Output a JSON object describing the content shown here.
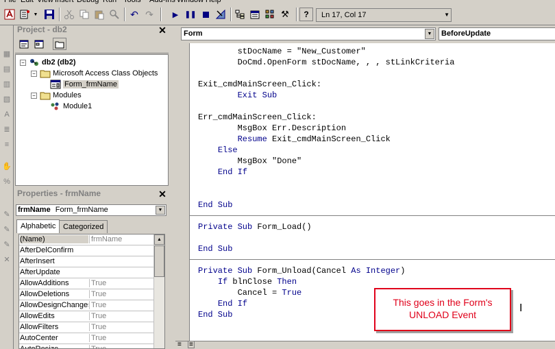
{
  "menu": [
    "File",
    "Edit",
    "View",
    "Insert",
    "Debug",
    "Run",
    "Tools",
    "Add-Ins",
    "Window",
    "Help"
  ],
  "toolbar": {
    "position_label": "Ln 17, Col 17",
    "icons": [
      "access-icon",
      "insert-module-icon",
      "save-icon",
      "cut-icon",
      "copy-icon",
      "paste-icon",
      "find-icon",
      "undo-icon",
      "redo-icon",
      "run-icon",
      "break-icon",
      "reset-icon",
      "design-mode-icon",
      "project-explorer-icon",
      "properties-icon",
      "object-browser-icon",
      "toolbox-icon",
      "help-icon"
    ]
  },
  "project": {
    "title": "Project - db2",
    "tree": [
      {
        "label": "db2 (db2)",
        "icon": "vba-project-icon",
        "expander": "−"
      },
      {
        "label": "Microsoft Access Class Objects",
        "icon": "folder-icon",
        "expander": "−"
      },
      {
        "label": "Form_frmName",
        "icon": "form-icon",
        "expander": ""
      },
      {
        "label": "Modules",
        "icon": "folder-icon",
        "expander": "−"
      },
      {
        "label": "Module1",
        "icon": "module-icon",
        "expander": ""
      }
    ]
  },
  "properties": {
    "title": "Properties - frmName",
    "object_name": "frmName",
    "object_type": "Form_frmName",
    "tabs": [
      "Alphabetic",
      "Categorized"
    ],
    "rows": [
      {
        "name": "(Name)",
        "value": "frmName"
      },
      {
        "name": "AfterDelConfirm",
        "value": ""
      },
      {
        "name": "AfterInsert",
        "value": ""
      },
      {
        "name": "AfterUpdate",
        "value": ""
      },
      {
        "name": "AllowAdditions",
        "value": "True"
      },
      {
        "name": "AllowDeletions",
        "value": "True"
      },
      {
        "name": "AllowDesignChanges",
        "value": "True"
      },
      {
        "name": "AllowEdits",
        "value": "True"
      },
      {
        "name": "AllowFilters",
        "value": "True"
      },
      {
        "name": "AutoCenter",
        "value": "True"
      },
      {
        "name": "AutoResize",
        "value": "True"
      }
    ]
  },
  "code": {
    "object_combo": "Form",
    "procedure_combo": "BeforeUpdate",
    "lines": [
      [
        {
          "t": "        stDocName = \"New_Customer\""
        }
      ],
      [
        {
          "t": "        DoCmd.OpenForm stDocName, , , stLinkCriteria"
        }
      ],
      [
        {
          "t": ""
        }
      ],
      [
        {
          "t": "Exit_cmdMainScreen_Click:"
        }
      ],
      [
        {
          "t": "        "
        },
        {
          "t": "Exit Sub",
          "kw": true
        }
      ],
      [
        {
          "t": ""
        }
      ],
      [
        {
          "t": "Err_cmdMainScreen_Click:"
        }
      ],
      [
        {
          "t": "        MsgBox Err.Description"
        }
      ],
      [
        {
          "t": "        "
        },
        {
          "t": "Resume",
          "kw": true
        },
        {
          "t": " Exit_cmdMainScreen_Click"
        }
      ],
      [
        {
          "t": "    "
        },
        {
          "t": "Else",
          "kw": true
        }
      ],
      [
        {
          "t": "        MsgBox \"Done\""
        }
      ],
      [
        {
          "t": "    "
        },
        {
          "t": "End If",
          "kw": true
        }
      ],
      [
        {
          "t": ""
        }
      ],
      [
        {
          "t": ""
        }
      ],
      [
        {
          "t": "End Sub",
          "kw": true
        }
      ],
      [
        {
          "t": "",
          "divider": true
        }
      ],
      [
        {
          "t": "Private Sub",
          "kw": true
        },
        {
          "t": " Form_Load()"
        }
      ],
      [
        {
          "t": ""
        }
      ],
      [
        {
          "t": "End Sub",
          "kw": true
        }
      ],
      [
        {
          "t": "",
          "divider": true
        }
      ],
      [
        {
          "t": "Private Sub",
          "kw": true
        },
        {
          "t": " Form_Unload(Cancel "
        },
        {
          "t": "As Integer",
          "kw": true
        },
        {
          "t": ")"
        }
      ],
      [
        {
          "t": "    "
        },
        {
          "t": "If",
          "kw": true
        },
        {
          "t": " blnClose "
        },
        {
          "t": "Then",
          "kw": true
        }
      ],
      [
        {
          "t": "        Cancel = "
        },
        {
          "t": "True",
          "kw": true
        }
      ],
      [
        {
          "t": "    "
        },
        {
          "t": "End If",
          "kw": true
        }
      ],
      [
        {
          "t": "End Sub",
          "kw": true
        }
      ]
    ]
  },
  "annotation": {
    "line1": "This goes in the Form's",
    "line2": "UNLOAD Event",
    "color": "#e0001a"
  },
  "colors": {
    "chrome": "#d4d0c8",
    "keyword": "#00008b",
    "annotation": "#e0001a"
  }
}
